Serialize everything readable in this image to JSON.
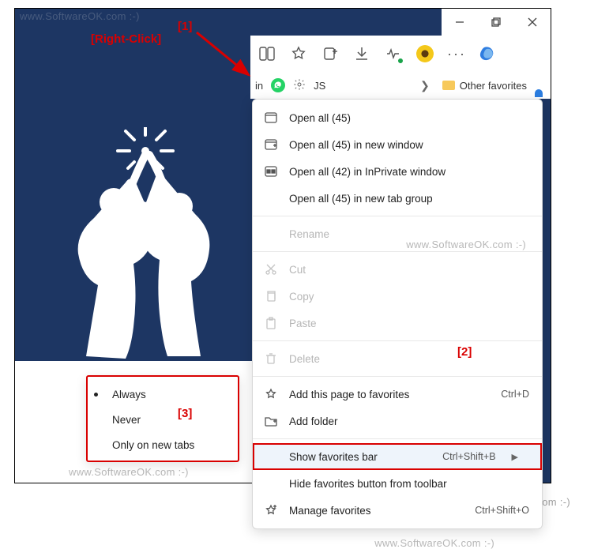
{
  "window": {
    "annotations": {
      "rightclick": "[Right-Click]",
      "step1": "[1]",
      "step2": "[2]",
      "step3": "[3]"
    }
  },
  "favbar": {
    "whatsapp_tip": "WhatsApp",
    "js_label": "JS",
    "other_favorites": "Other favorites"
  },
  "menu": {
    "open_all": "Open all (45)",
    "open_all_new_window": "Open all (45) in new window",
    "open_all_inprivate": "Open all (42) in InPrivate window",
    "open_all_tabgroup": "Open all (45) in new tab group",
    "rename": "Rename",
    "cut": "Cut",
    "copy": "Copy",
    "paste": "Paste",
    "delete": "Delete",
    "add_page": "Add this page to favorites",
    "add_page_short": "Ctrl+D",
    "add_folder": "Add folder",
    "show_favbar": "Show favorites bar",
    "show_favbar_short": "Ctrl+Shift+B",
    "hide_favbutton": "Hide favorites button from toolbar",
    "manage": "Manage favorites",
    "manage_short": "Ctrl+Shift+O"
  },
  "submenu": {
    "always": "Always",
    "never": "Never",
    "only_new_tabs": "Only on new tabs"
  },
  "watermark": "www.SoftwareOK.com :-)"
}
